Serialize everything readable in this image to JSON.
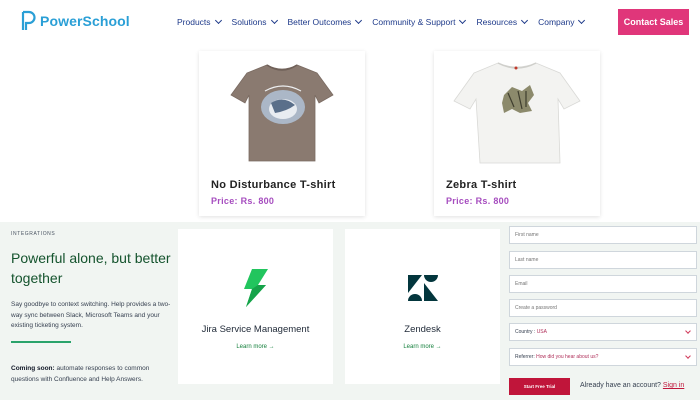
{
  "nav": {
    "logo_text": "PowerSchool",
    "items": [
      {
        "label": "Products"
      },
      {
        "label": "Solutions"
      },
      {
        "label": "Better Outcomes"
      },
      {
        "label": "Community & Support"
      },
      {
        "label": "Resources"
      },
      {
        "label": "Company"
      }
    ],
    "cta_label": "Contact Sales",
    "cta_color": "#e0367a",
    "logo_color": "#2a9fd6"
  },
  "products": [
    {
      "name": "No Disturbance T-shirt",
      "price": "Price: Rs. 800",
      "shirt_color": "#8a7a70"
    },
    {
      "name": "Zebra T-shirt",
      "price": "Price: Rs. 800",
      "shirt_color": "#f3f3f1"
    }
  ],
  "integrations": {
    "eyebrow": "INTEGRATIONS",
    "headline": "Powerful alone, but better together",
    "description": "Say goodbye to context switching. Help provides a two-way sync between Slack, Microsoft Teams and your existing ticketing system.",
    "soon_bold": "Coming soon:",
    "soon_text": " automate responses to common questions with Confluence and Help Answers.",
    "cards": [
      {
        "title": "Jira Service Management",
        "link": "Learn more →",
        "icon": "jira-icon"
      },
      {
        "title": "Zendesk",
        "link": "Learn more →",
        "icon": "zendesk-icon"
      }
    ]
  },
  "form": {
    "first_name_placeholder": "First name",
    "last_name_placeholder": "Last name",
    "email_placeholder": "Email",
    "password_placeholder": "Create a password",
    "country_label": "Country : ",
    "country_value": "USA",
    "referral_label": "Referrer: ",
    "referral_question": "How did you hear about us?",
    "submit_label": "Start Free Trial",
    "account_text": "Already have an account? ",
    "signin_label": "Sign in"
  }
}
